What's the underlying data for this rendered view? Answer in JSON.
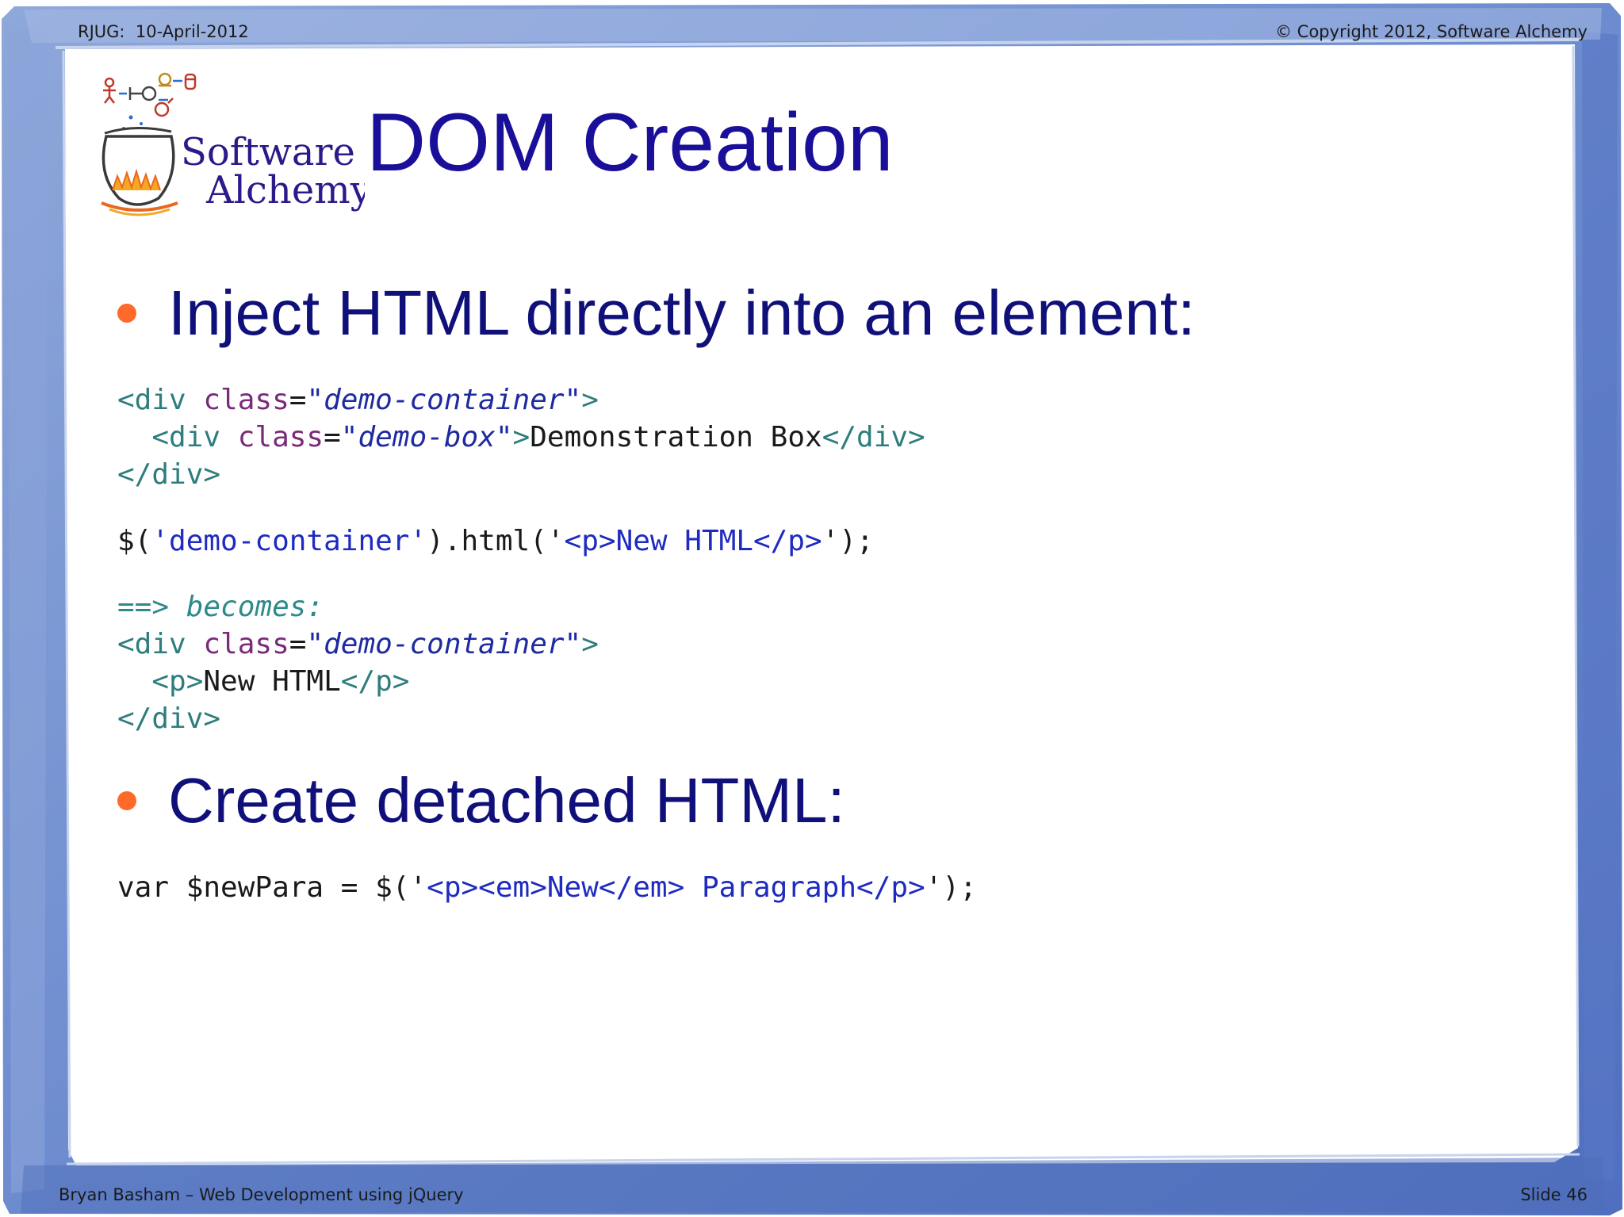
{
  "header": {
    "left": "RJUG:  10-April-2012",
    "right": "© Copyright 2012, Software Alchemy"
  },
  "footer": {
    "left": "Bryan Basham – Web Development using jQuery",
    "right": "Slide 46"
  },
  "logo": {
    "line1": "Software",
    "line2": "Alchemy"
  },
  "title": "DOM Creation",
  "bullets": [
    "Inject HTML directly into an element:",
    "Create detached HTML:"
  ],
  "code": {
    "block1": {
      "l1_tag_open": "<div ",
      "l1_attr": "class",
      "l1_eq": "=",
      "l1_val": "\"demo-container\"",
      "l1_close": ">",
      "l2_tag_open": "  <div ",
      "l2_attr": "class",
      "l2_eq": "=",
      "l2_val": "\"demo-box\"",
      "l2_close": ">",
      "l2_text": "Demonstration Box",
      "l2_end": "</div>",
      "l3": "</div>"
    },
    "block2": {
      "p1": "$(",
      "s1": "'demo-container'",
      "p2": ").html(",
      "s2a": "'",
      "s2b": "<p>New HTML</p>",
      "s2c": "'",
      "p3": ");"
    },
    "block3": {
      "arrow": "==> becomes:",
      "l1_tag_open": "<div ",
      "l1_attr": "class",
      "l1_eq": "=",
      "l1_val": "\"demo-container\"",
      "l1_close": ">",
      "l2_open": "  <p>",
      "l2_text": "New HTML",
      "l2_close": "</p>",
      "l3": "</div>"
    },
    "block4": {
      "p1": "var $newPara = $(",
      "s1": "'",
      "s2": "<p><em>New</em> Paragraph</p>",
      "s3": "'",
      "p2": ");"
    }
  },
  "colors": {
    "title": "#1a0f99",
    "bullet_text": "#10107a",
    "bullet_dot": "#ff6a2a",
    "frame": "#6f8fd0"
  }
}
